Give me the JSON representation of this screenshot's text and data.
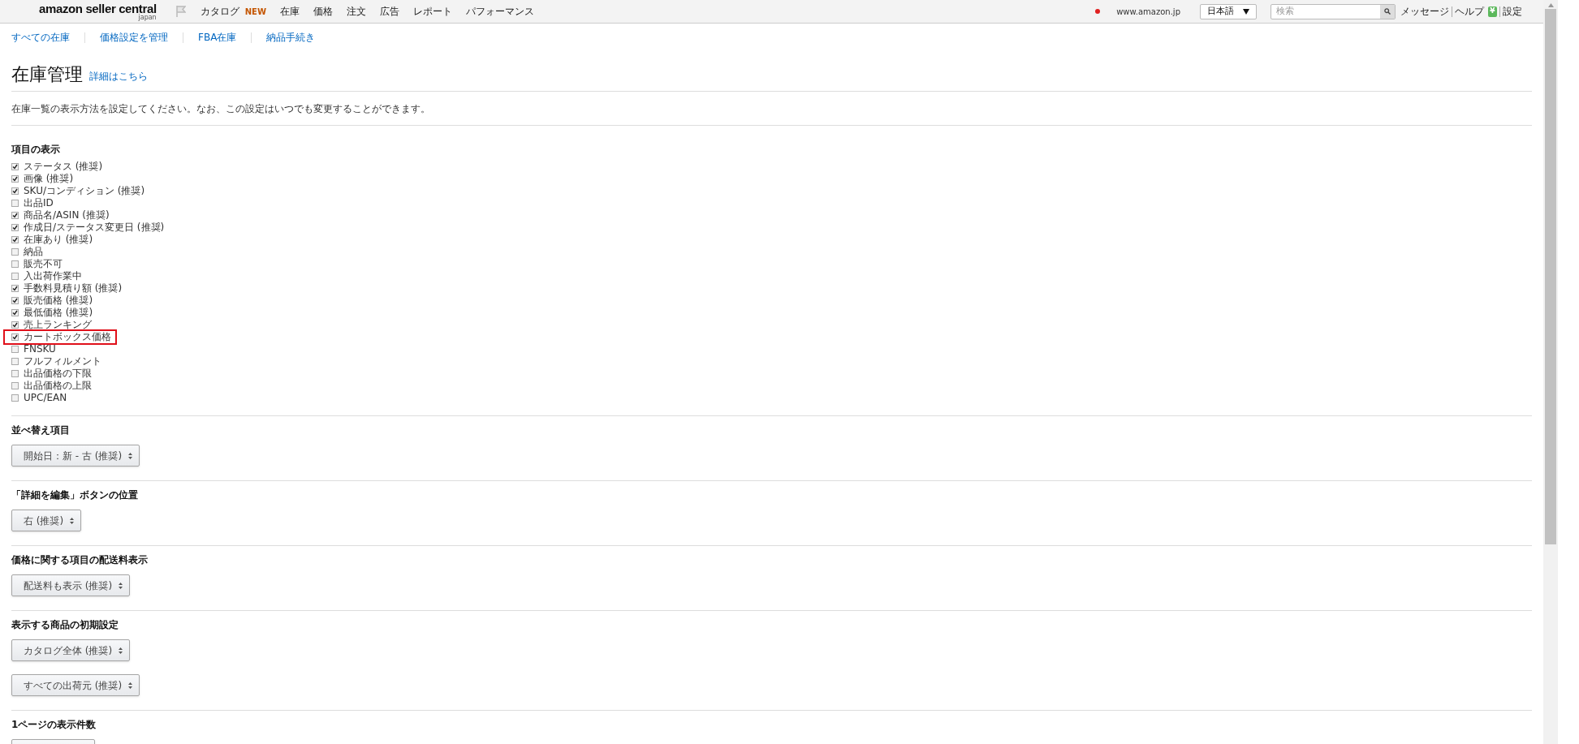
{
  "header": {
    "logo": "amazon seller central",
    "logo_sub": "japan",
    "nav": [
      {
        "label": "カタログ",
        "badge": "NEW"
      },
      {
        "label": "在庫"
      },
      {
        "label": "価格"
      },
      {
        "label": "注文"
      },
      {
        "label": "広告"
      },
      {
        "label": "レポート"
      },
      {
        "label": "パフォーマンス"
      }
    ],
    "marketplace": "www.amazon.jp",
    "language": "日本語",
    "search": {
      "placeholder": "検索"
    },
    "links": [
      "メッセージ",
      "ヘルプ"
    ],
    "yen_badge": "¥",
    "settings": "設定"
  },
  "subnav": [
    "すべての在庫",
    "価格設定を管理",
    "FBA在庫",
    "納品手続き"
  ],
  "page": {
    "title": "在庫管理",
    "title_link": "詳細はこちら",
    "description": "在庫一覧の表示方法を設定してください。なお、この設定はいつでも変更することができます。"
  },
  "columns_section": {
    "heading": "項目の表示",
    "items": [
      {
        "label": "ステータス (推奨)",
        "checked": true,
        "highlighted": false
      },
      {
        "label": "画像 (推奨)",
        "checked": true,
        "highlighted": false
      },
      {
        "label": "SKU/コンディション (推奨)",
        "checked": true,
        "highlighted": false
      },
      {
        "label": "出品ID",
        "checked": false,
        "highlighted": false
      },
      {
        "label": "商品名/ASIN (推奨)",
        "checked": true,
        "highlighted": false
      },
      {
        "label": "作成日/ステータス変更日 (推奨)",
        "checked": true,
        "highlighted": false
      },
      {
        "label": "在庫あり (推奨)",
        "checked": true,
        "highlighted": false
      },
      {
        "label": "納品",
        "checked": false,
        "highlighted": false
      },
      {
        "label": "販売不可",
        "checked": false,
        "highlighted": false
      },
      {
        "label": "入出荷作業中",
        "checked": false,
        "highlighted": false
      },
      {
        "label": "手数料見積り額 (推奨)",
        "checked": true,
        "highlighted": false
      },
      {
        "label": "販売価格 (推奨)",
        "checked": true,
        "highlighted": false
      },
      {
        "label": "最低価格 (推奨)",
        "checked": true,
        "highlighted": false
      },
      {
        "label": "売上ランキング",
        "checked": true,
        "highlighted": false
      },
      {
        "label": "カートボックス価格",
        "checked": true,
        "highlighted": true
      },
      {
        "label": "FNSKU",
        "checked": false,
        "highlighted": false
      },
      {
        "label": "フルフィルメント",
        "checked": false,
        "highlighted": false
      },
      {
        "label": "出品価格の下限",
        "checked": false,
        "highlighted": false
      },
      {
        "label": "出品価格の上限",
        "checked": false,
        "highlighted": false
      },
      {
        "label": "UPC/EAN",
        "checked": false,
        "highlighted": false
      }
    ]
  },
  "settings_sections": [
    {
      "heading": "並べ替え項目",
      "selects": [
        "開始日：新 - 古 (推奨)"
      ]
    },
    {
      "heading": "「詳細を編集」ボタンの位置",
      "selects": [
        "右 (推奨)"
      ]
    },
    {
      "heading": "価格に関する項目の配送料表示",
      "selects": [
        "配送料も表示 (推奨)"
      ]
    },
    {
      "heading": "表示する商品の初期設定",
      "selects": [
        "カタログ全体 (推奨)",
        "すべての出荷元 (推奨)"
      ]
    },
    {
      "heading": "1ページの表示件数"
    }
  ]
}
